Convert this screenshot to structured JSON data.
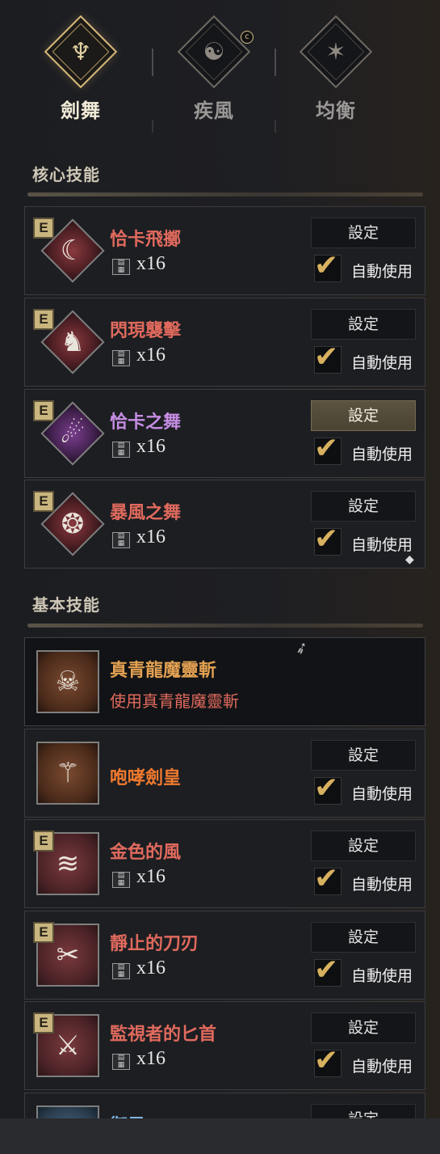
{
  "tabs": [
    {
      "label": "劍舞",
      "icon": "sword-dance-emblem-icon",
      "active": true
    },
    {
      "label": "疾風",
      "icon": "gale-emblem-icon",
      "active": false
    },
    {
      "label": "均衡",
      "icon": "balance-emblem-icon",
      "active": false
    }
  ],
  "sections": {
    "core": "核心技能",
    "basic": "基本技能"
  },
  "common": {
    "set_label": "設定",
    "auto_label": "自動使用"
  },
  "core_skills": [
    {
      "name": "恰卡飛擲",
      "count": "x16",
      "badge": "E",
      "auto": true,
      "set_active": false
    },
    {
      "name": "閃現襲擊",
      "count": "x16",
      "badge": "E",
      "auto": true,
      "set_active": false
    },
    {
      "name": "恰卡之舞",
      "count": "x16",
      "badge": "E",
      "auto": true,
      "set_active": true
    },
    {
      "name": "暴風之舞",
      "count": "x16",
      "badge": "E",
      "auto": true,
      "set_active": false
    }
  ],
  "basic_skills": [
    {
      "name": "真青龍魔靈斬",
      "subtitle": "使用真青龍魔靈斬"
    },
    {
      "name": "咆哮劍皇",
      "auto": true
    },
    {
      "name": "金色的風",
      "count": "x16",
      "badge": "E",
      "auto": true
    },
    {
      "name": "靜止的刀刃",
      "count": "x16",
      "badge": "E",
      "auto": true
    },
    {
      "name": "監視者的匕首",
      "count": "x16",
      "badge": "E",
      "auto": true
    },
    {
      "name": "御風",
      "partial": true
    }
  ],
  "colors": {
    "accent_gold": "#d7b979",
    "skill_red": "#e06a5d",
    "skill_purple": "#c58de3",
    "skill_orange": "#f07a2f"
  }
}
